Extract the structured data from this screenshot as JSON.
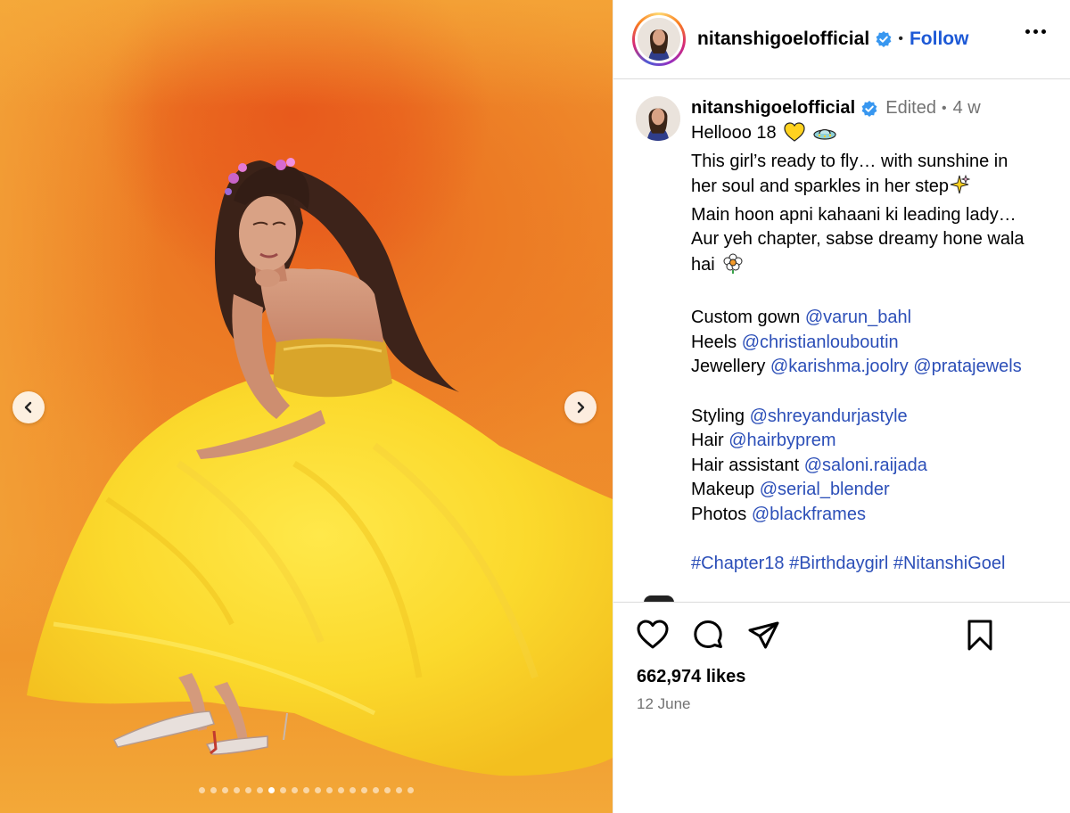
{
  "post": {
    "username": "nitanshigoelofficial",
    "follow_label": "Follow",
    "separator": "•",
    "more_icon": "more-horizontal-icon"
  },
  "caption": {
    "username": "nitanshigoelofficial",
    "edited": "Edited",
    "separator": "•",
    "time": "4 w",
    "lines": {
      "l1": "Hellooo 18",
      "l2": "This girl’s ready to fly… with sunshine in",
      "l3": "her soul and sparkles in her step",
      "l4": "Main hoon apni kahaani ki leading lady…",
      "l5": "Aur yeh chapter, sabse dreamy hone wala",
      "l6": "hai"
    },
    "credits": {
      "gown_label": "Custom gown",
      "gown_tag": "@varun_bahl",
      "heels_label": "Heels",
      "heels_tag": "@christianlouboutin",
      "jewellery_label": "Jewellery",
      "jewellery_tag1": "@karishma.joolry",
      "jewellery_tag2": "@pratajewels",
      "styling_label": "Styling",
      "styling_tag": "@shreyandurjastyle",
      "hair_label": "Hair",
      "hair_tag": "@hairbyprem",
      "hair_assistant_label": "Hair assistant",
      "hair_assistant_tag": "@saloni.raijada",
      "makeup_label": "Makeup",
      "makeup_tag": "@serial_blender",
      "photos_label": "Photos",
      "photos_tag": "@blackframes"
    },
    "hashtags": [
      "#Chapter18",
      "#Birthdaygirl",
      "#NitanshiGoel"
    ],
    "emojis": [
      "yellow-heart-emoji",
      "flying-saucer-emoji",
      "sparkles-emoji",
      "flower-emoji"
    ]
  },
  "engagement": {
    "likes": "662,974 likes",
    "date": "12 June"
  },
  "carousel": {
    "total": 19,
    "active": 6
  },
  "colors": {
    "link": "#2c4fb8",
    "follow": "#1d59d6",
    "verified": "#3897f0",
    "muted": "#737373"
  }
}
